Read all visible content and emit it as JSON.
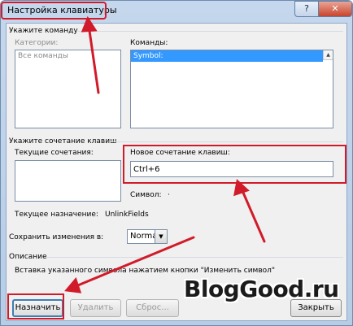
{
  "window": {
    "title": "Настройка клавиатуры",
    "help_glyph": "?",
    "close_glyph": "✕"
  },
  "commands_group": {
    "label": "Укажите команду",
    "categories_label": "Категории:",
    "categories_items": [
      "Все команды"
    ],
    "commands_label": "Команды:",
    "commands_items": [
      "Symbol:"
    ]
  },
  "shortcut_group": {
    "label": "Укажите сочетание клавиш",
    "current_keys_label": "Текущие сочетания:",
    "new_shortcut_label": "Новое сочетание клавиш:",
    "new_shortcut_value": "Ctrl+6",
    "symbol_label": "Символ:",
    "symbol_value": "·",
    "current_assignment_label": "Текущее назначение:",
    "current_assignment_value": "UnlinkFields"
  },
  "save_changes": {
    "label": "Сохранить изменения в:",
    "selected": "Normal"
  },
  "description": {
    "label": "Описание",
    "text": "Вставка указанного символа нажатием кнопки \"Изменить символ\""
  },
  "buttons": {
    "assign": "Назначить",
    "remove": "Удалить",
    "reset": "Сброс...",
    "close": "Закрыть"
  },
  "watermark": "BlogGood.ru",
  "colors": {
    "annotation_red": "#d11b2a",
    "selection_blue": "#3399ff",
    "titlebar": "#c5d7ec"
  }
}
